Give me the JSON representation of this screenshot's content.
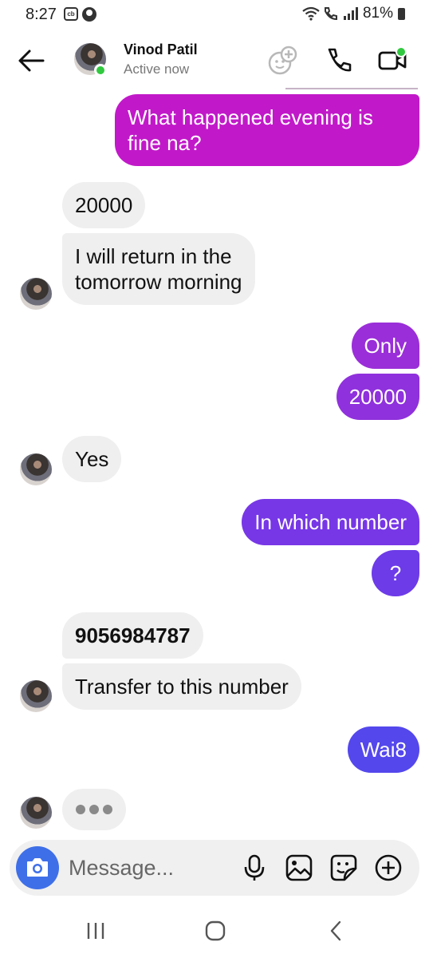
{
  "status_bar": {
    "time": "8:27",
    "cb_badge": "cb",
    "battery": "81%",
    "icons": [
      "cb-icon",
      "account-icon",
      "wifi-icon",
      "wifi-calling-icon",
      "signal-icon",
      "battery-icon"
    ]
  },
  "header": {
    "name": "Vinod Patil",
    "status": "Active now",
    "icons": [
      "back-arrow-icon",
      "add-people-icon",
      "phone-icon",
      "video-call-icon"
    ]
  },
  "messages": [
    {
      "side": "out",
      "text": "What happened evening is\nfine na?",
      "color": "#c119c9"
    },
    {
      "side": "in",
      "text": "20000"
    },
    {
      "side": "in",
      "text": "I will return in the\ntomorrow morning"
    },
    {
      "side": "out",
      "text": "Only",
      "color": "#9a2ed8"
    },
    {
      "side": "out",
      "text": "20000",
      "color": "#8f31dc"
    },
    {
      "side": "in",
      "text": "Yes"
    },
    {
      "side": "out",
      "text": "In which number",
      "color": "#7737e6"
    },
    {
      "side": "out",
      "text": "?",
      "color": "#6d3be8"
    },
    {
      "side": "in",
      "text": "9056984787"
    },
    {
      "side": "in",
      "text": "Transfer to this number"
    },
    {
      "side": "out",
      "text": "Wai8",
      "color": "#5447ec"
    }
  ],
  "composer": {
    "placeholder": "Message...",
    "icons": [
      "camera-icon",
      "microphone-icon",
      "gallery-icon",
      "sticker-icon",
      "plus-icon"
    ]
  },
  "nav": {
    "icons": [
      "recent-apps-icon",
      "home-icon",
      "back-icon"
    ]
  }
}
